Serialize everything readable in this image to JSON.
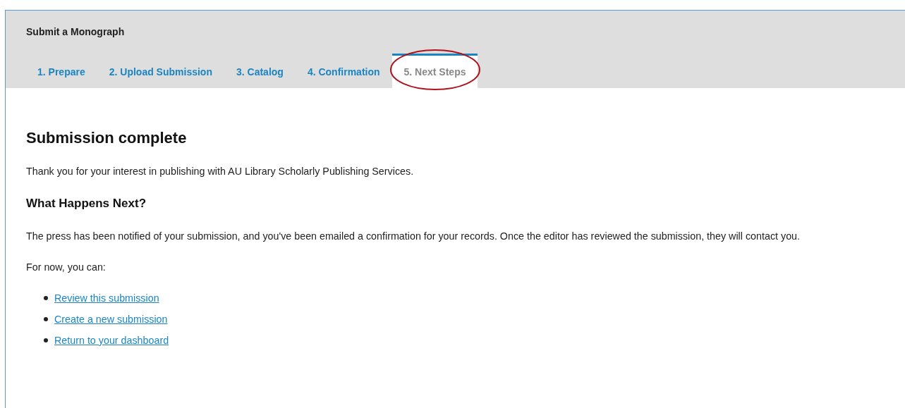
{
  "header": {
    "title": "Submit a Monograph"
  },
  "tabs": [
    {
      "label": "1. Prepare",
      "selected": false,
      "circled": false
    },
    {
      "label": "2. Upload Submission",
      "selected": false,
      "circled": false
    },
    {
      "label": "3. Catalog",
      "selected": false,
      "circled": false
    },
    {
      "label": "4. Confirmation",
      "selected": false,
      "circled": false
    },
    {
      "label": "5. Next Steps",
      "selected": true,
      "circled": true
    }
  ],
  "content": {
    "heading": "Submission complete",
    "intro": "Thank you for your interest in publishing with AU Library Scholarly Publishing Services.",
    "subheading": "What Happens Next?",
    "notice": "The press has been notified of your submission, and you've been emailed a confirmation for your records. Once the editor has reviewed the submission, they will contact you.",
    "prompt": "For now, you can:",
    "links": [
      "Review this submission",
      "Create a new submission",
      "Return to your dashboard"
    ]
  }
}
